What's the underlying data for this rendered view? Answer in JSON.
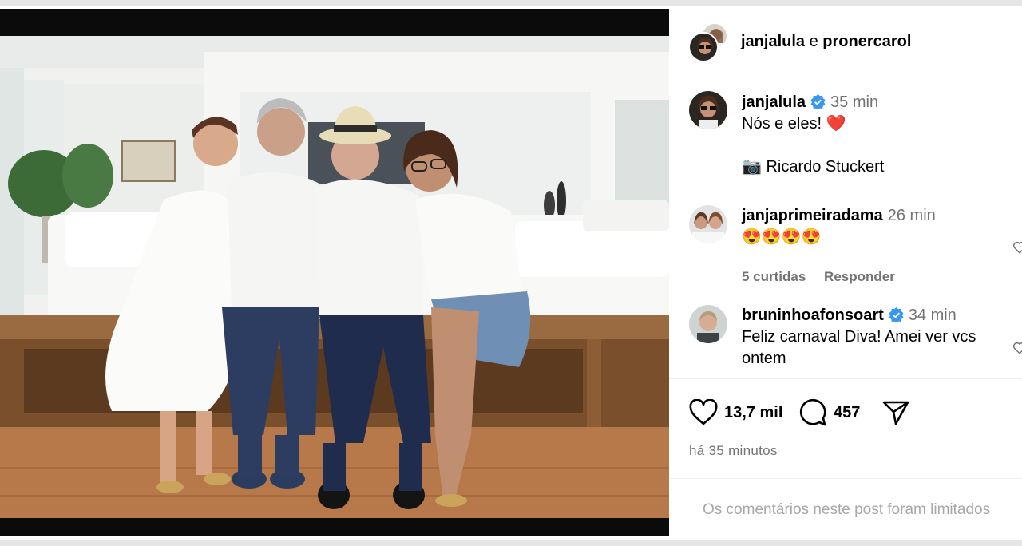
{
  "header": {
    "user1": "janjalula",
    "separator": "e",
    "user2": "pronercarol"
  },
  "caption": {
    "username": "janjalula",
    "time": "35 min",
    "line1": "Nós e eles! ❤️",
    "line2": "📷 Ricardo Stuckert"
  },
  "comments": [
    {
      "username": "janjaprimeiradama",
      "time": "26 min",
      "text": "😍😍😍😍",
      "likes": "5 curtidas",
      "reply": "Responder"
    },
    {
      "username": "bruninhoafonsoart",
      "time": "34 min",
      "text": "Feliz carnaval Diva! Amei ver vcs ontem"
    }
  ],
  "actions": {
    "likes_count": "13,7 mil",
    "comments_count": "457",
    "posted_ago": "há 35 minutos"
  },
  "footer": {
    "limited_text": "Os comentários neste post foram limitados"
  },
  "icons": {
    "like": "heart-icon",
    "comment": "comment-icon",
    "share": "send-icon",
    "verified": "verified-badge-icon",
    "camera": "camera-emoji"
  },
  "colors": {
    "verified": "#3897f0",
    "secondary_text": "#737373",
    "muted_text": "#a8a8a8",
    "divider": "#efefef"
  }
}
